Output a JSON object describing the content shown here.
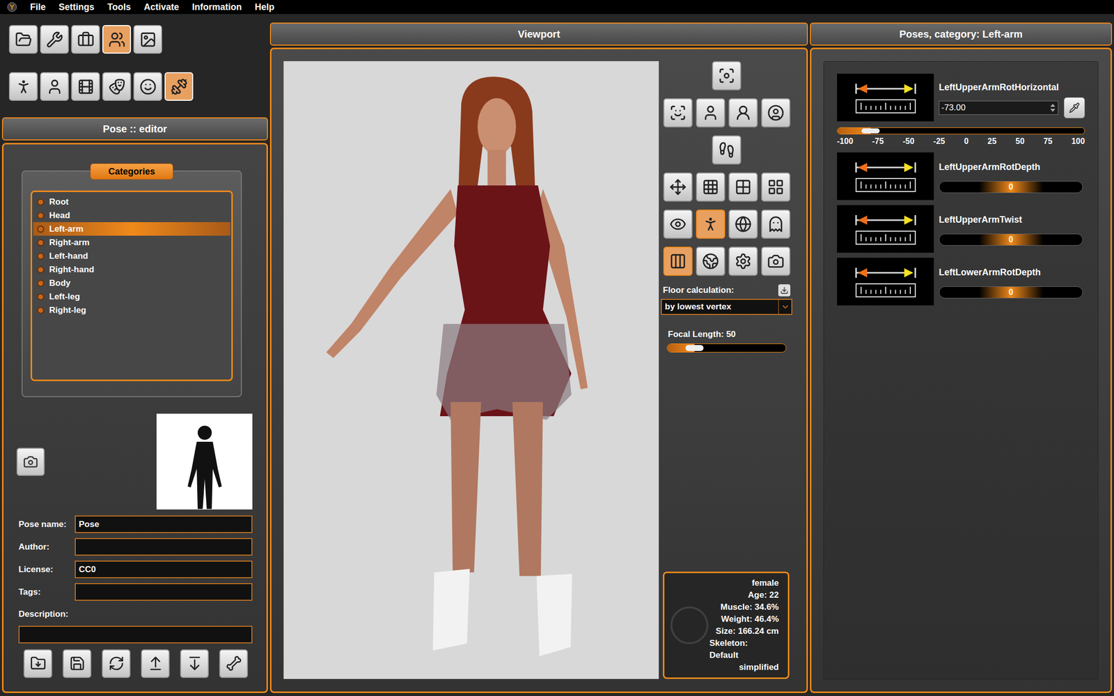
{
  "menu": [
    "File",
    "Settings",
    "Tools",
    "Activate",
    "Information",
    "Help"
  ],
  "main_tabs": [
    {
      "selected": false
    },
    {
      "selected": false
    },
    {
      "selected": false
    },
    {
      "selected": true
    },
    {
      "selected": false
    }
  ],
  "sub_tabs": [
    {
      "selected": false
    },
    {
      "selected": false
    },
    {
      "selected": false
    },
    {
      "selected": false
    },
    {
      "selected": false
    },
    {
      "selected": true
    }
  ],
  "left_panel": {
    "title": "Pose :: editor",
    "categories_label": "Categories",
    "categories": [
      {
        "label": "Root",
        "selected": false
      },
      {
        "label": "Head",
        "selected": false
      },
      {
        "label": "Left-arm",
        "selected": true
      },
      {
        "label": "Right-arm",
        "selected": false
      },
      {
        "label": "Left-hand",
        "selected": false
      },
      {
        "label": "Right-hand",
        "selected": false
      },
      {
        "label": "Body",
        "selected": false
      },
      {
        "label": "Left-leg",
        "selected": false
      },
      {
        "label": "Right-leg",
        "selected": false
      }
    ]
  },
  "pose_form": {
    "fields": [
      {
        "label": "Pose name:",
        "value": "Pose"
      },
      {
        "label": "Author:",
        "value": ""
      },
      {
        "label": "License:",
        "value": "CC0"
      },
      {
        "label": "Tags:",
        "value": ""
      }
    ],
    "description_label": "Description:",
    "description": ""
  },
  "viewport": {
    "title": "Viewport",
    "tools": [
      {
        "selected": false
      },
      {
        "selected": false
      },
      {
        "selected": false
      },
      {
        "selected": false
      },
      {
        "selected": false
      },
      {
        "selected": false
      },
      {
        "selected": false
      },
      {
        "selected": false
      },
      {
        "selected": false
      },
      {
        "selected": false
      },
      {
        "selected": false
      },
      {
        "selected": true
      },
      {
        "selected": false
      },
      {
        "selected": false
      },
      {
        "selected": true
      },
      {
        "selected": false
      },
      {
        "selected": false
      },
      {
        "selected": false
      }
    ],
    "floor_label": "Floor calculation:",
    "floor_value": "by lowest vertex",
    "focal_label": "Focal Length: 50",
    "focal_level": 0.23,
    "info": [
      "female",
      "Age: 22",
      "Muscle: 34.6%",
      "Weight: 46.4%",
      "Size: 166.24 cm",
      "Skeleton: Default",
      "simplified"
    ]
  },
  "right_panel": {
    "title": "Poses, category: Left-arm",
    "modifiers": [
      {
        "name": "LeftUpperArmRotHorizontal",
        "kind": "expanded",
        "value": "-73.00",
        "level": 0.135,
        "ticks": [
          "-100",
          "-75",
          "-50",
          "-25",
          "0",
          "25",
          "50",
          "75",
          "100"
        ]
      },
      {
        "name": "LeftUpperArmRotDepth",
        "kind": "compact",
        "value": "0",
        "level": 0.5
      },
      {
        "name": "LeftUpperArmTwist",
        "kind": "compact",
        "value": "0",
        "level": 0.5
      },
      {
        "name": "LeftLowerArmRotDepth",
        "kind": "compact",
        "value": "0",
        "level": 0.5
      }
    ]
  }
}
